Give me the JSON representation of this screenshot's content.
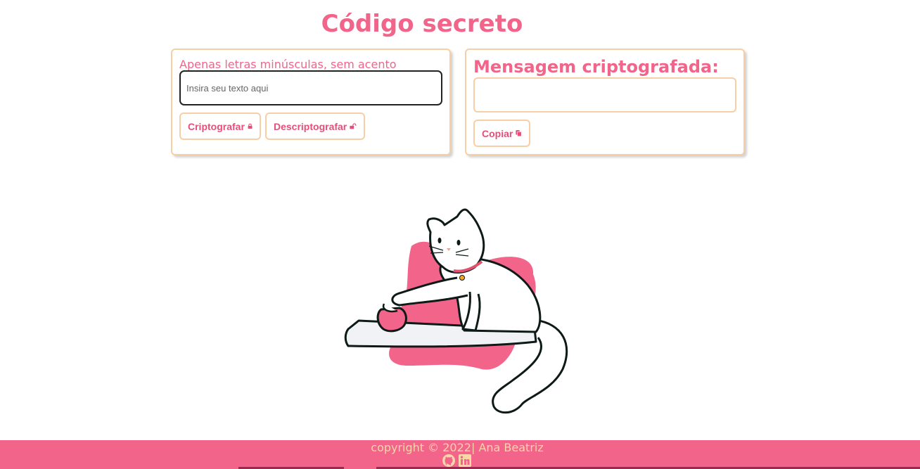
{
  "header": {
    "title": "Código secreto"
  },
  "encrypt_panel": {
    "hint": "Apenas letras minúsculas, sem acento",
    "input_placeholder": "Insira seu texto aqui",
    "input_value": "",
    "encrypt_label": "Criptografar",
    "decrypt_label": "Descriptografar"
  },
  "output_panel": {
    "title": "Mensagem criptografada:",
    "output_value": "",
    "copy_label": "Copiar"
  },
  "footer": {
    "copyright": "copyright © 2022| Ana Beatriz",
    "links": [
      {
        "icon": "github-icon"
      },
      {
        "icon": "linkedin-icon"
      }
    ]
  },
  "colors": {
    "accent": "#f2648a",
    "border": "#f7cfa6",
    "footer_text": "#f7d6a8"
  }
}
